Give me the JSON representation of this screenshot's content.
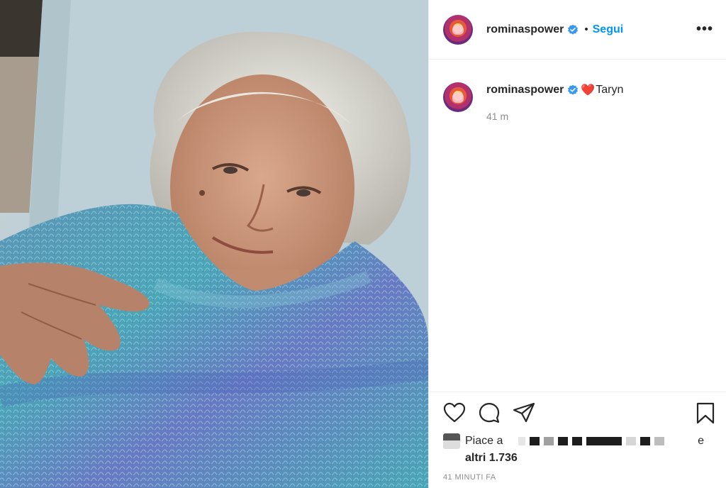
{
  "post": {
    "username": "rominaspower",
    "follow_label": "Segui",
    "more_label": "•••",
    "caption_emoji": "❤️",
    "caption_text": "Taryn",
    "caption_time": "41 m",
    "likes_prefix": "Piace a",
    "likes_suffix": "e",
    "likes_count_text": "altri 1.736",
    "post_date": "41 MINUTI FA"
  },
  "colors": {
    "accent": "#0095f6",
    "verified": "#3897f0",
    "muted": "#8e8e8e",
    "text": "#262626"
  },
  "icons": {
    "like": "heart-icon",
    "comment": "comment-icon",
    "share": "share-icon",
    "save": "bookmark-icon",
    "verified": "verified-badge-icon"
  }
}
